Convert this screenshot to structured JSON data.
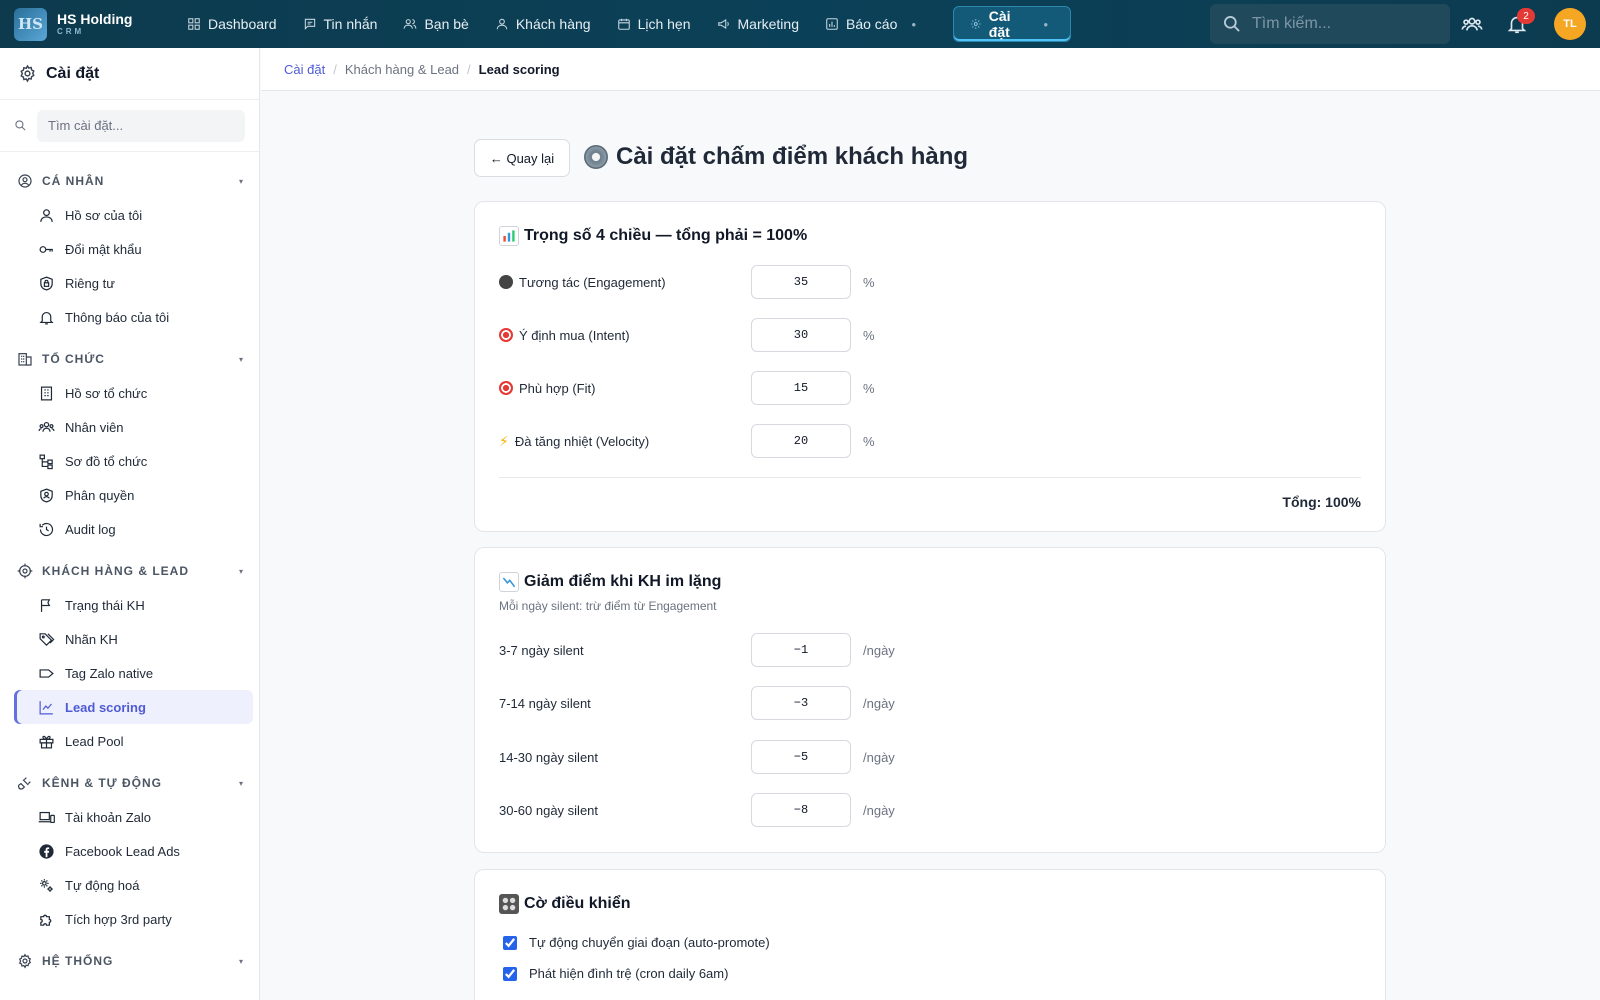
{
  "brand": {
    "logo": "HS",
    "name": "HS Holding",
    "sub": "CRM"
  },
  "nav": [
    {
      "label": "Dashboard",
      "icon": "dashboard-icon"
    },
    {
      "label": "Tin nhắn",
      "icon": "message-icon"
    },
    {
      "label": "Bạn bè",
      "icon": "friends-icon"
    },
    {
      "label": "Khách hàng",
      "icon": "customer-icon"
    },
    {
      "label": "Lịch hẹn",
      "icon": "calendar-icon"
    },
    {
      "label": "Marketing",
      "icon": "megaphone-icon"
    },
    {
      "label": "Báo cáo",
      "icon": "report-icon"
    },
    {
      "label": "Cài đặt",
      "icon": "gear-icon",
      "active": true
    }
  ],
  "search": {
    "placeholder": "Tìm kiếm..."
  },
  "notifications": {
    "count": "2"
  },
  "user": {
    "initials": "TL"
  },
  "sidebar": {
    "title": "Cài đặt",
    "search_placeholder": "Tìm cài đặt...",
    "sections": [
      {
        "label": "CÁ NHÂN",
        "items": [
          "Hồ sơ của tôi",
          "Đổi mật khẩu",
          "Riêng tư",
          "Thông báo của tôi"
        ]
      },
      {
        "label": "TỔ CHỨC",
        "items": [
          "Hồ sơ tổ chức",
          "Nhân viên",
          "Sơ đồ tổ chức",
          "Phân quyền",
          "Audit log"
        ]
      },
      {
        "label": "KHÁCH HÀNG & LEAD",
        "items": [
          "Trạng thái KH",
          "Nhãn KH",
          "Tag Zalo native",
          "Lead scoring",
          "Lead Pool"
        ]
      },
      {
        "label": "KÊNH & TỰ ĐỘNG",
        "items": [
          "Tài khoản Zalo",
          "Facebook Lead Ads",
          "Tự động hoá",
          "Tích hợp 3rd party"
        ]
      },
      {
        "label": "HỆ THỐNG",
        "items": []
      }
    ],
    "active_item": "Lead scoring"
  },
  "breadcrumb": {
    "root": "Cài đặt",
    "section": "Khách hàng & Lead",
    "current": "Lead scoring"
  },
  "page": {
    "back_label": "← Quay lại",
    "title": "Cài đặt chấm điểm khách hàng"
  },
  "weights": {
    "title": "Trọng số 4 chiều — tổng phải = 100%",
    "rows": [
      {
        "label": "Tương tác (Engagement)",
        "value": "35",
        "unit": "%"
      },
      {
        "label": "Ý định mua (Intent)",
        "value": "30",
        "unit": "%"
      },
      {
        "label": "Phù hợp (Fit)",
        "value": "15",
        "unit": "%"
      },
      {
        "label": "Đà tăng nhiệt (Velocity)",
        "value": "20",
        "unit": "%"
      }
    ],
    "total": "Tổng: 100%"
  },
  "decay": {
    "title": "Giảm điểm khi KH im lặng",
    "subtitle": "Mỗi ngày silent: trừ điểm từ Engagement",
    "rows": [
      {
        "label": "3-7 ngày silent",
        "value": "−1",
        "unit": "/ngày"
      },
      {
        "label": "7-14 ngày silent",
        "value": "−3",
        "unit": "/ngày"
      },
      {
        "label": "14-30 ngày silent",
        "value": "−5",
        "unit": "/ngày"
      },
      {
        "label": "30-60 ngày silent",
        "value": "−8",
        "unit": "/ngày"
      }
    ]
  },
  "flags": {
    "title": "Cờ điều khiển",
    "items": [
      {
        "label": "Tự động chuyển giai đoạn (auto-promote)",
        "checked": true
      },
      {
        "label": "Phát hiện đình trệ (cron daily 6am)",
        "checked": true
      }
    ]
  },
  "colors": {
    "topbar": "#0d3a4d",
    "accent": "#4f5bd5",
    "active_nav": "#125a78",
    "badge": "#e53935",
    "avatar": "#f5a623"
  }
}
